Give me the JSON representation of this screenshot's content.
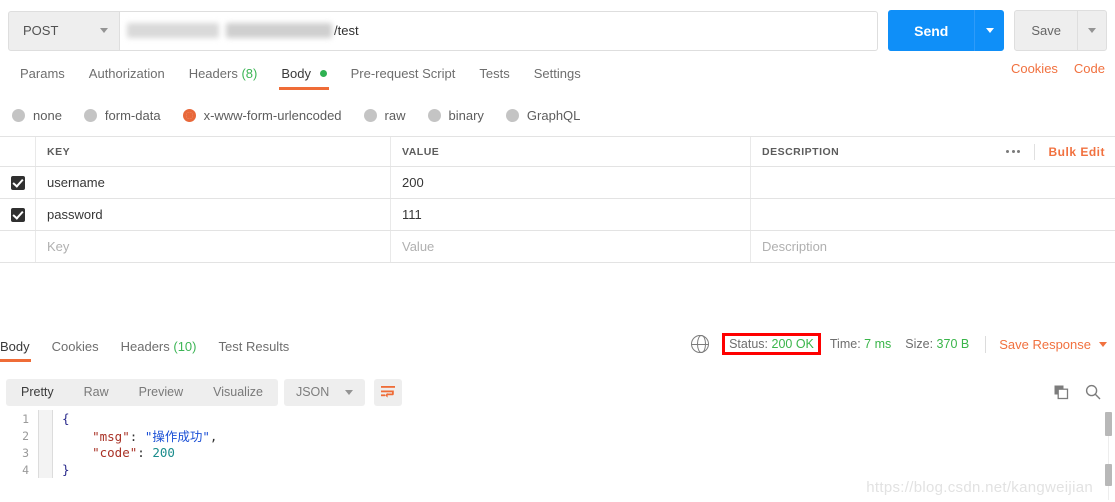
{
  "request": {
    "method": "POST",
    "url_suffix": "/test",
    "url_redacted": true,
    "send_label": "Send",
    "save_label": "Save",
    "tabs": [
      {
        "label": "Params",
        "active": false
      },
      {
        "label": "Authorization",
        "active": false
      },
      {
        "label": "Headers",
        "count": "(8)",
        "active": false
      },
      {
        "label": "Body",
        "active": true,
        "dot": true
      },
      {
        "label": "Pre-request Script",
        "active": false
      },
      {
        "label": "Tests",
        "active": false
      },
      {
        "label": "Settings",
        "active": false
      }
    ],
    "right_links": [
      {
        "label": "Cookies"
      },
      {
        "label": "Code"
      }
    ],
    "body_types": [
      {
        "label": "none",
        "selected": false
      },
      {
        "label": "form-data",
        "selected": false
      },
      {
        "label": "x-www-form-urlencoded",
        "selected": true
      },
      {
        "label": "raw",
        "selected": false
      },
      {
        "label": "binary",
        "selected": false
      },
      {
        "label": "GraphQL",
        "selected": false
      }
    ],
    "table": {
      "headers": {
        "key": "KEY",
        "value": "VALUE",
        "description": "DESCRIPTION"
      },
      "bulk_edit_label": "Bulk Edit",
      "rows": [
        {
          "checked": true,
          "key": "username",
          "value": "200",
          "description": ""
        },
        {
          "checked": true,
          "key": "password",
          "value": "111",
          "description": ""
        }
      ],
      "placeholder_row": {
        "key": "Key",
        "value": "Value",
        "description": "Description"
      }
    }
  },
  "response": {
    "tabs": [
      {
        "label": "Body",
        "active": true
      },
      {
        "label": "Cookies",
        "active": false
      },
      {
        "label": "Headers",
        "count": "(10)",
        "active": false
      },
      {
        "label": "Test Results",
        "active": false
      }
    ],
    "meta": {
      "status_label": "Status:",
      "status_value": "200 OK",
      "status_highlighted": true,
      "time_label": "Time:",
      "time_value": "7 ms",
      "size_label": "Size:",
      "size_value": "370 B",
      "save_response_label": "Save Response"
    },
    "view_tabs": [
      {
        "label": "Pretty",
        "active": true
      },
      {
        "label": "Raw",
        "active": false
      },
      {
        "label": "Preview",
        "active": false
      },
      {
        "label": "Visualize",
        "active": false
      }
    ],
    "format": "JSON",
    "body_lines": [
      {
        "num": "1",
        "indent": 0,
        "tokens": [
          {
            "t": "brace",
            "v": "{"
          }
        ]
      },
      {
        "num": "2",
        "indent": 1,
        "tokens": [
          {
            "t": "key",
            "v": "\"msg\""
          },
          {
            "t": "punct",
            "v": ": "
          },
          {
            "t": "str",
            "v": "\"操作成功\""
          },
          {
            "t": "punct",
            "v": ","
          }
        ]
      },
      {
        "num": "3",
        "indent": 1,
        "tokens": [
          {
            "t": "key",
            "v": "\"code\""
          },
          {
            "t": "punct",
            "v": ": "
          },
          {
            "t": "num",
            "v": "200"
          }
        ]
      },
      {
        "num": "4",
        "indent": 0,
        "tokens": [
          {
            "t": "brace",
            "v": "}"
          }
        ]
      }
    ]
  },
  "watermark": "https://blog.csdn.net/kangweijian",
  "colors": {
    "accent_orange": "#ef6c37",
    "send_blue": "#0f8ff8",
    "status_green": "#3ab54a",
    "annotation_red": "#fe0000"
  }
}
